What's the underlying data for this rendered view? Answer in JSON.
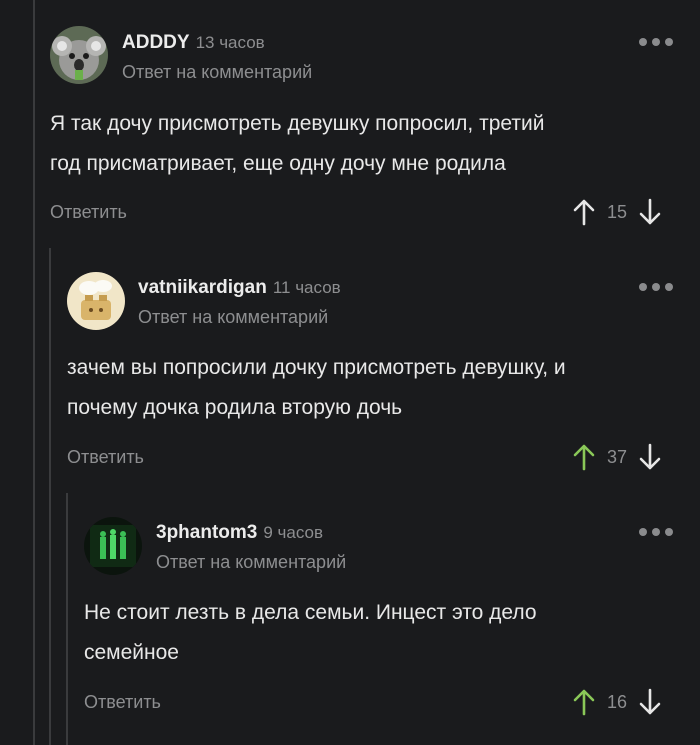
{
  "comments": [
    {
      "author": "ADDDY",
      "time": "13 часов",
      "reply_to": "Ответ на комментарий",
      "text_lines": [
        "Я так дочу присмотреть девушку попросил, третий",
        "год присматривает, еще одну дочу мне родила"
      ],
      "reply_label": "Ответить",
      "votes": "15",
      "upvote_active": false,
      "avatar_icon": "koala-avatar-icon"
    },
    {
      "author": "vatniikardigan",
      "time": "11 часов",
      "reply_to": "Ответ на комментарий",
      "text_lines": [
        "зачем вы попросили дочку присмотреть девушку, и",
        "почему дочка родила вторую дочь"
      ],
      "reply_label": "Ответить",
      "votes": "37",
      "upvote_active": true,
      "avatar_icon": "toaster-avatar-icon"
    },
    {
      "author": "3phantom3",
      "time": "9 часов",
      "reply_to": "Ответ на комментарий",
      "text_lines": [
        "Не стоит лезть в дела семьи. Инцест это дело",
        "семейное"
      ],
      "reply_label": "Ответить",
      "votes": "16",
      "upvote_active": true,
      "avatar_icon": "green-figures-avatar-icon"
    }
  ],
  "colors": {
    "background": "#1a1b1d",
    "upvote_active": "#8ac858",
    "muted": "#8d8e90",
    "thread_line": "#3a3b3d"
  }
}
